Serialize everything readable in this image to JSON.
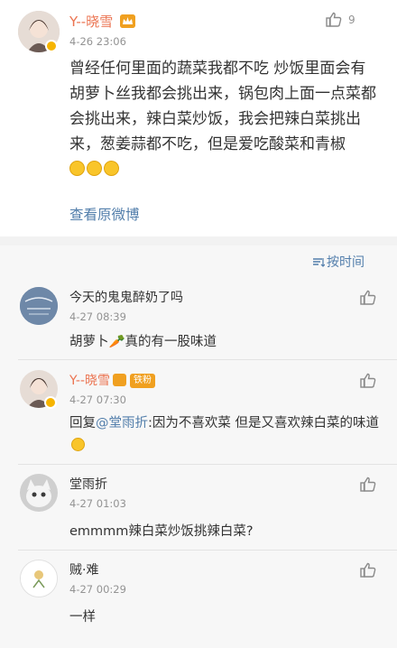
{
  "post": {
    "author": "Y--晓雪",
    "time": "4-26 23:06",
    "like_count": "9",
    "text": "曾经任何里面的蔬菜我都不吃 炒饭里面会有胡萝卜丝我都会挑出来，锅包肉上面一点菜都会挑出来，辣白菜炒饭，我会把辣白菜挑出来，葱姜蒜都不吃，但是爱吃酸菜和青椒",
    "view_original": "查看原微博"
  },
  "sort_label": "按时间",
  "comments": [
    {
      "name": "今天的鬼鬼醉奶了吗",
      "time": "4-27 08:39",
      "text": "胡萝卜🥕真的有一股味道"
    },
    {
      "name": "Y--晓雪",
      "badge": "铁粉",
      "time": "4-27 07:30",
      "reply_prefix": "回复",
      "reply_user": "@堂雨折",
      "reply_text": ":因为不喜欢菜 但是又喜欢辣白菜的味道"
    },
    {
      "name": "堂雨折",
      "time": "4-27 01:03",
      "text": "emmmm辣白菜炒饭挑辣白菜?"
    },
    {
      "name": "贼·难",
      "time": "4-27 00:29",
      "text": "一样"
    }
  ],
  "colors": {
    "name": "#eb7350",
    "link": "#527eab",
    "time": "#939393"
  },
  "icons": [
    "like-icon",
    "crown-icon",
    "verified-badge-icon",
    "sort-icon",
    "laugh-emoji-icon"
  ]
}
